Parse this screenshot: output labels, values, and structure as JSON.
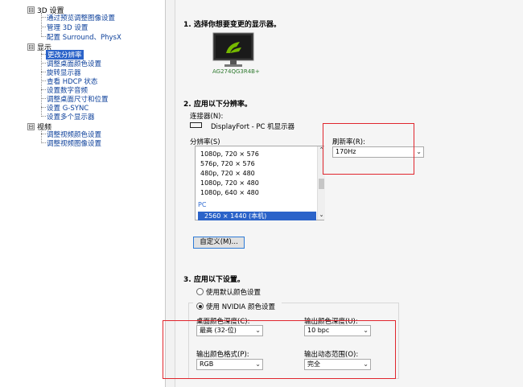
{
  "tree": {
    "categories": [
      {
        "label": "3D 设置",
        "items": [
          "通过预览调整图像设置",
          "管理 3D 设置",
          "配置 Surround、PhysX"
        ]
      },
      {
        "label": "显示",
        "items": [
          "更改分辨率",
          "调整桌面颜色设置",
          "旋转显示器",
          "查看 HDCP 状态",
          "设置数字音频",
          "调整桌面尺寸和位置",
          "设置 G-SYNC",
          "设置多个显示器"
        ]
      },
      {
        "label": "视频",
        "items": [
          "调整视频颜色设置",
          "调整视频图像设置"
        ]
      }
    ],
    "selected": "更改分辨率"
  },
  "main": {
    "section1": {
      "title": "1. 选择你想要变更的显示器。",
      "monitor_name": "AG274QG3R4B+"
    },
    "section2": {
      "title": "2. 应用以下分辨率。",
      "connector_label": "连接器(N):",
      "connector_value": "DisplayFort - PC 机显示器",
      "resolution_label": "分辨率(S)",
      "resolutions": [
        "1080p, 720 × 576",
        "576p, 720 × 576",
        "480p, 720 × 480",
        "1080p, 720 × 480",
        "1080p, 640 × 480"
      ],
      "pc_group": "PC",
      "selected_resolution": "2560 × 1440 (本机)",
      "refresh_label": "刷新率(R):",
      "refresh_value": "170Hz",
      "custom_button": "自定义(M)..."
    },
    "section3": {
      "title": "3. 应用以下设置。",
      "radio_default": "使用默认颜色设置",
      "radio_nvidia": "使用 NVIDIA 颜色设置",
      "desktop_depth_label": "桌面颜色深度(C):",
      "desktop_depth_value": "最高 (32-位)",
      "output_depth_label": "输出颜色深度(U):",
      "output_depth_value": "10 bpc",
      "color_format_label": "输出颜色格式(P):",
      "color_format_value": "RGB",
      "dynamic_range_label": "输出动态范围(O):",
      "dynamic_range_value": "完全"
    }
  },
  "icons": {
    "expander": "⊟",
    "dropdown": "⌄",
    "scroll_up": "⌃",
    "scroll_down": "⌄"
  },
  "colors": {
    "selection": "#2b63c9",
    "link": "#0b3f9a",
    "highlight_box": "#e0262d",
    "nvidia_green": "#76b900"
  }
}
